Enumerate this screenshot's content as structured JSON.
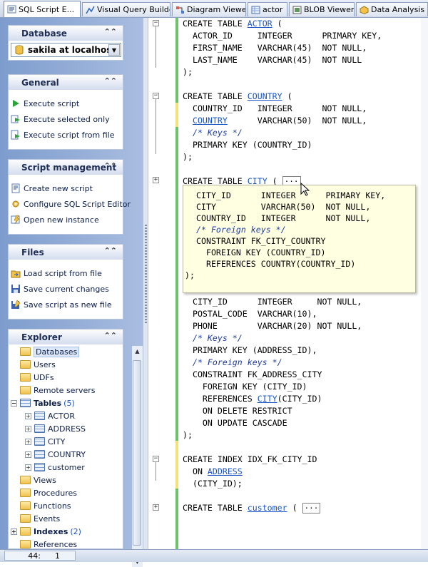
{
  "tabs": [
    {
      "label": "SQL Script E...",
      "icon": "sql-script-icon",
      "active": true
    },
    {
      "label": "Visual Query Builder",
      "icon": "query-builder-icon"
    },
    {
      "label": "Diagram Viewer",
      "icon": "diagram-icon"
    },
    {
      "label": "actor",
      "icon": "table-icon"
    },
    {
      "label": "BLOB Viewer",
      "icon": "blob-icon"
    },
    {
      "label": "Data Analysis",
      "icon": "data-analysis-icon"
    }
  ],
  "sidebar": {
    "database": {
      "title": "Database",
      "selected": "sakila at localhost"
    },
    "general": {
      "title": "General",
      "items": [
        "Execute script",
        "Execute selected only",
        "Execute script from file"
      ]
    },
    "script_management": {
      "title": "Script management",
      "items": [
        "Create new script",
        "Configure SQL Script Editor",
        "Open new instance"
      ]
    },
    "files": {
      "title": "Files",
      "items": [
        "Load script from file",
        "Save current changes",
        "Save script as new file"
      ]
    },
    "explorer": {
      "title": "Explorer",
      "items": [
        {
          "label": "Databases"
        },
        {
          "label": "Users"
        },
        {
          "label": "UDFs"
        },
        {
          "label": "Remote servers"
        },
        {
          "label": "Tables",
          "count": "(5)"
        },
        {
          "label": "ACTOR"
        },
        {
          "label": "ADDRESS"
        },
        {
          "label": "CITY"
        },
        {
          "label": "COUNTRY"
        },
        {
          "label": "customer"
        },
        {
          "label": "Views"
        },
        {
          "label": "Procedures"
        },
        {
          "label": "Functions"
        },
        {
          "label": "Events"
        },
        {
          "label": "Indexes",
          "count": "(2)"
        },
        {
          "label": "References"
        }
      ]
    }
  },
  "editor": {
    "lines": [
      [
        "CREATE TABLE ",
        "ACTOR",
        " ("
      ],
      [
        "  ACTOR_ID     INTEGER      PRIMARY KEY,"
      ],
      [
        "  FIRST_NAME   VARCHAR(45)  NOT NULL,"
      ],
      [
        "  LAST_NAME    VARCHAR(45)  NOT NULL"
      ],
      [
        ");"
      ],
      [
        "CREATE TABLE ",
        "COUNTRY",
        " ("
      ],
      [
        "  COUNTRY_ID   INTEGER      NOT NULL,"
      ],
      [
        "  ",
        "COUNTRY",
        "      VARCHAR(50)  NOT NULL,"
      ],
      [
        "  /* Keys */"
      ],
      [
        "  PRIMARY KEY (COUNTRY_ID)"
      ],
      [
        ");"
      ],
      [
        "CREATE TABLE ",
        "CITY",
        " ( "
      ],
      [
        "  CITY_ID      INTEGER     NOT NULL,"
      ],
      [
        "  POSTAL_CODE  VARCHAR(10),"
      ],
      [
        "  PHONE        VARCHAR(20) NOT NULL,"
      ],
      [
        "  /* Keys */"
      ],
      [
        "  PRIMARY KEY (ADDRESS_ID),"
      ],
      [
        "  /* Foreign keys */"
      ],
      [
        "  CONSTRAINT FK_ADDRESS_CITY"
      ],
      [
        "    FOREIGN KEY (CITY_ID)"
      ],
      [
        "    REFERENCES ",
        "CITY",
        "(CITY_ID)"
      ],
      [
        "    ON DELETE RESTRICT"
      ],
      [
        "    ON UPDATE CASCADE"
      ],
      [
        ");"
      ],
      [
        "CREATE INDEX IDX_FK_CITY_ID"
      ],
      [
        "  ON ",
        "ADDRESS"
      ],
      [
        "  (CITY_ID);"
      ],
      [
        "CREATE TABLE ",
        "customer",
        " ( "
      ]
    ],
    "collapsed_marker": "...",
    "popup_lines": [
      "CITY_ID      INTEGER      PRIMARY KEY,",
      "CITY         VARCHAR(50)  NOT NULL,",
      "COUNTRY_ID   INTEGER      NOT NULL,",
      "/* Foreign keys */",
      "CONSTRAINT FK_CITY_COUNTRY",
      "  FOREIGN KEY (COUNTRY_ID)",
      "  REFERENCES COUNTRY(COUNTRY_ID)",
      ");"
    ]
  },
  "status": {
    "line": "44:",
    "col": "1"
  },
  "colors": {
    "link": "#1a55c8",
    "changed_saved": "#6ac46a",
    "changed_unsaved": "#f2e27a",
    "popup_bg": "#ffffe1"
  }
}
